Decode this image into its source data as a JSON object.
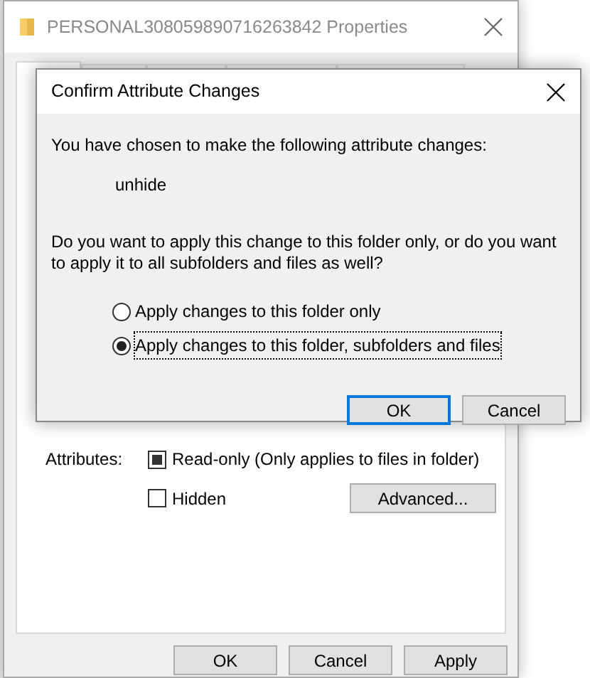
{
  "properties_window": {
    "title": "PERSONAL308059890716263842 Properties",
    "tabs": [
      {
        "selected": true
      },
      {
        "selected": false
      },
      {
        "selected": false
      },
      {
        "selected": false
      },
      {
        "selected": false
      }
    ],
    "attributes_label": "Attributes:",
    "attributes": [
      {
        "label": "Read-only (Only applies to files in folder)",
        "mixed": true
      },
      {
        "label": "Hidden",
        "mixed": false
      }
    ],
    "advanced_button": "Advanced...",
    "buttons": [
      {
        "label": "OK",
        "default": false
      },
      {
        "label": "Cancel",
        "default": false
      },
      {
        "label": "Apply",
        "default": false
      }
    ]
  },
  "dialog": {
    "title": "Confirm Attribute Changes",
    "intro": "You have chosen to make the following attribute changes:",
    "change": "unhide",
    "question": "Do you want to apply this change to this folder only, or do you want to apply it to all subfolders and files as well?",
    "options": [
      {
        "label": "Apply changes to this folder only",
        "selected": false
      },
      {
        "label": "Apply changes to this folder, subfolders and files",
        "selected": true
      }
    ],
    "buttons": [
      {
        "label": "OK",
        "default": true
      },
      {
        "label": "Cancel",
        "default": false
      }
    ]
  }
}
